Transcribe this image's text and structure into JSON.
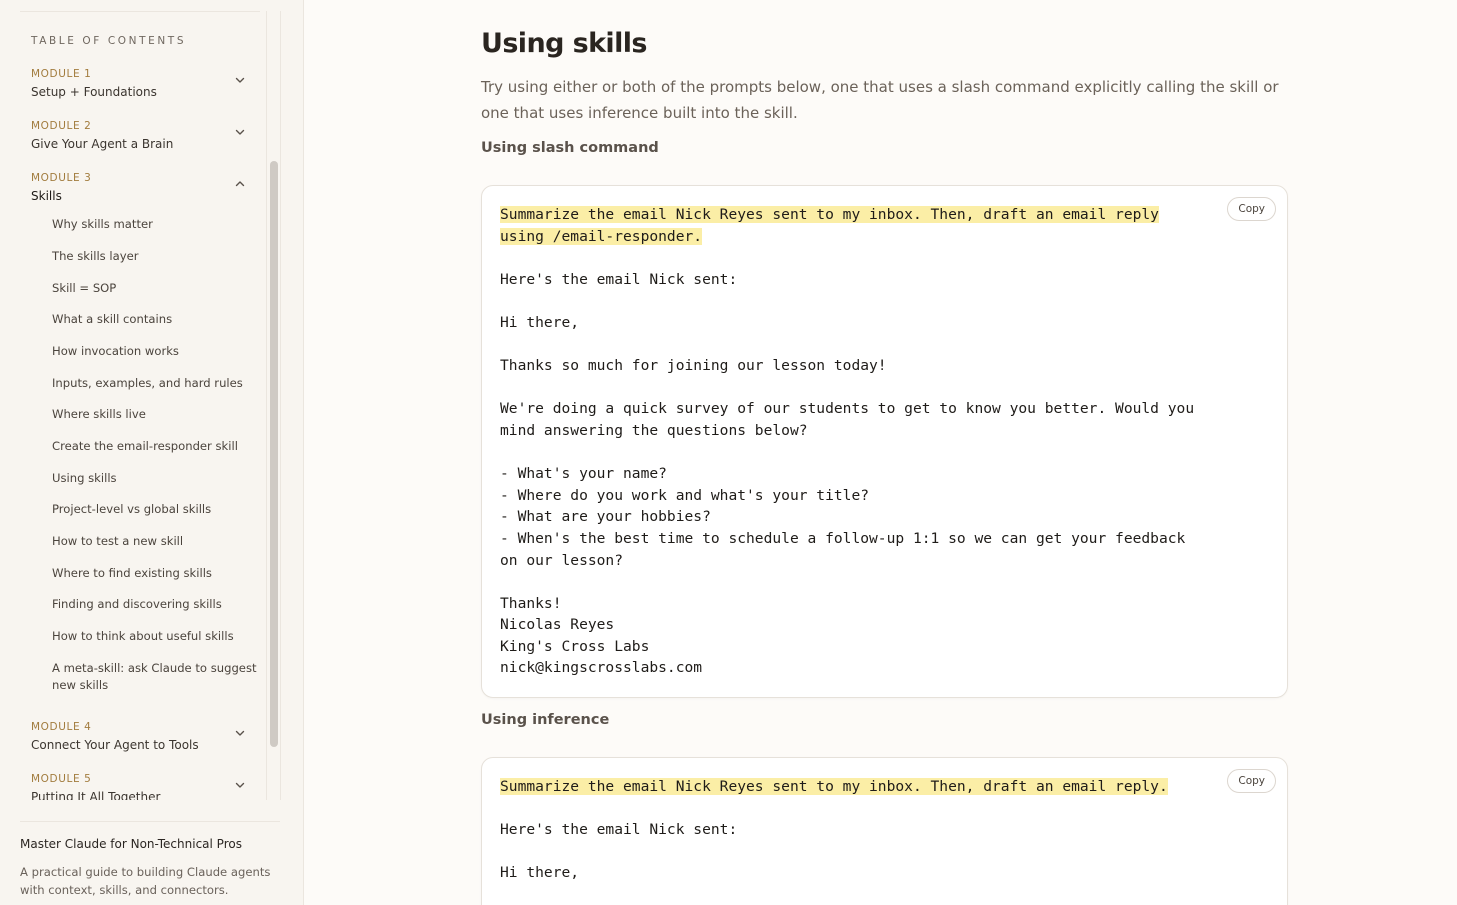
{
  "sidebar": {
    "toc_heading": "TABLE OF CONTENTS",
    "modules": [
      {
        "kicker": "MODULE 1",
        "title": "Setup + Foundations",
        "expanded": false
      },
      {
        "kicker": "MODULE 2",
        "title": "Give Your Agent a Brain",
        "expanded": false
      },
      {
        "kicker": "MODULE 3",
        "title": "Skills",
        "expanded": true
      },
      {
        "kicker": "MODULE 4",
        "title": "Connect Your Agent to Tools",
        "expanded": false
      },
      {
        "kicker": "MODULE 5",
        "title": "Putting It All Together",
        "expanded": false
      }
    ],
    "module3_items": [
      "Why skills matter",
      "The skills layer",
      "Skill = SOP",
      "What a skill contains",
      "How invocation works",
      "Inputs, examples, and hard rules",
      "Where skills live",
      "Create the email-responder skill",
      "Using skills",
      "Project-level vs global skills",
      "How to test a new skill",
      "Where to find existing skills",
      "Finding and discovering skills",
      "How to think about useful skills",
      "A meta-skill: ask Claude to suggest new skills"
    ],
    "footer": {
      "title": "Master Claude for Non-Technical Pros",
      "description": "A practical guide to building Claude agents with context, skills, and connectors."
    }
  },
  "main": {
    "title": "Using skills",
    "intro": "Try using either or both of the prompts below, one that uses a slash command explicitly calling the skill or one that uses inference built into the skill.",
    "sections": [
      {
        "label": "Using slash command",
        "copy_label": "Copy",
        "highlight": "Summarize the email Nick Reyes sent to my inbox. Then, draft an email reply\nusing /email-responder.",
        "body": "\n\nHere's the email Nick sent:\n\nHi there,\n\nThanks so much for joining our lesson today!\n\nWe're doing a quick survey of our students to get to know you better. Would you\nmind answering the questions below?\n\n- What's your name?\n- Where do you work and what's your title?\n- What are your hobbies?\n- When's the best time to schedule a follow-up 1:1 so we can get your feedback\non our lesson?\n\nThanks!\nNicolas Reyes\nKing's Cross Labs\nnick@kingscrosslabs.com"
      },
      {
        "label": "Using inference",
        "copy_label": "Copy",
        "highlight": "Summarize the email Nick Reyes sent to my inbox. Then, draft an email reply.",
        "body": "\n\nHere's the email Nick sent:\n\nHi there,"
      }
    ]
  },
  "colors": {
    "accent_kicker": "#a27c3e",
    "highlight": "#fbeea6",
    "page_bg": "#fdfbf8",
    "sidebar_bg": "#f8f5f0"
  }
}
